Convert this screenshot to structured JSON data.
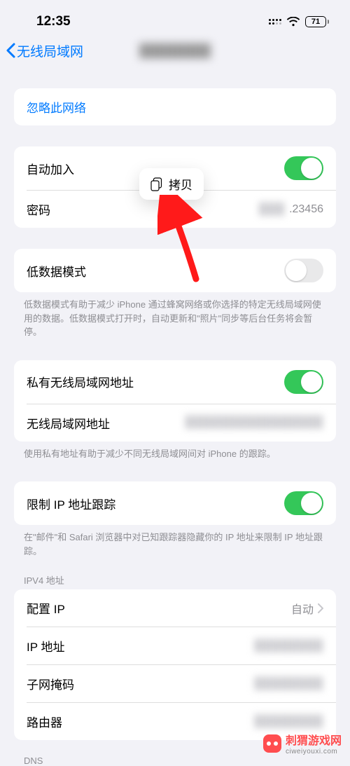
{
  "status": {
    "time": "12:35",
    "battery_pct": "71"
  },
  "nav": {
    "back_label": "无线局域网",
    "title": "████████"
  },
  "popover": {
    "copy_label": "拷贝"
  },
  "section_forget": {
    "forget_label": "忽略此网络"
  },
  "section_join": {
    "auto_join_label": "自动加入",
    "auto_join_on": true,
    "password_label": "密码",
    "password_masked": "███",
    "password_suffix": ".23456"
  },
  "section_lowdata": {
    "label": "低数据模式",
    "on": false,
    "footer": "低数据模式有助于减少 iPhone 通过蜂窝网络或你选择的特定无线局域网使用的数据。低数据模式打开时，自动更新和\"照片\"同步等后台任务将会暂停。"
  },
  "section_private": {
    "private_addr_label": "私有无线局域网地址",
    "private_on": true,
    "wifi_addr_label": "无线局域网地址",
    "wifi_addr_value": "████████████████",
    "footer": "使用私有地址有助于减少不同无线局域网间对 iPhone 的跟踪。"
  },
  "section_limit": {
    "label": "限制 IP 地址跟踪",
    "on": true,
    "footer": "在\"邮件\"和 Safari 浏览器中对已知跟踪器隐藏你的 IP 地址来限制 IP 地址跟踪。"
  },
  "ipv4": {
    "header": "IPV4 地址",
    "configure_label": "配置 IP",
    "configure_value": "自动",
    "ip_label": "IP 地址",
    "ip_value": "████████",
    "subnet_label": "子网掩码",
    "subnet_value": "████████",
    "router_label": "路由器",
    "router_value": "████████"
  },
  "dns": {
    "header": "DNS"
  },
  "watermark": {
    "line1": "刺猬游戏网",
    "line2": "ciweiyouxi.com"
  }
}
